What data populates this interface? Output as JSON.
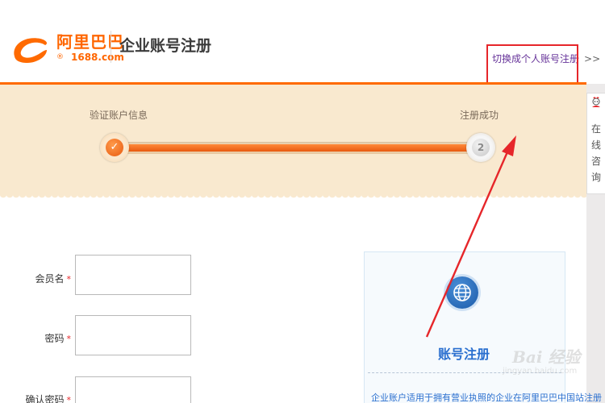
{
  "header": {
    "logo_cn": "阿里巴巴",
    "logo_reg": "®",
    "logo_en": "1688.com",
    "page_title": "企业账号注册",
    "switch_link": "切换成个人账号注册",
    "switch_arrows": ">>"
  },
  "progress": {
    "completed_fraction": 1.0,
    "steps": [
      {
        "label": "验证账户信息",
        "marker": "✓",
        "state": "done"
      },
      {
        "label": "注册成功",
        "marker": "2",
        "state": "pending"
      }
    ]
  },
  "side_tab": {
    "text": "在线咨询",
    "icon": "customer-service-icon"
  },
  "form": {
    "fields": [
      {
        "label": "会员名",
        "required_mark": "*",
        "value": "",
        "placeholder": ""
      },
      {
        "label": "密码",
        "required_mark": "*",
        "value": "",
        "placeholder": ""
      },
      {
        "label": "确认密码",
        "required_mark": "*",
        "value": "",
        "placeholder": ""
      }
    ]
  },
  "info_card": {
    "icon": "globe-icon",
    "title": "账号注册",
    "description": "企业账户适用于拥有营业执照的企业在阿里巴巴中国站注册"
  },
  "watermark": {
    "text": "Bai 经验",
    "url": "jingyan.baidu.com"
  },
  "colors": {
    "brand_orange": "#ff6a00",
    "progress_band": "#f9e9cf",
    "annotation_red": "#e6262a",
    "link_purple": "#663399",
    "card_blue": "#2a6fcf"
  }
}
